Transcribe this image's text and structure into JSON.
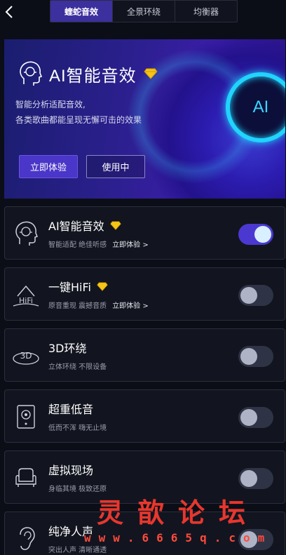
{
  "header": {
    "tabs": [
      {
        "label": "蝰蛇音效",
        "active": true
      },
      {
        "label": "全景环绕",
        "active": false
      },
      {
        "label": "均衡器",
        "active": false
      }
    ]
  },
  "banner": {
    "title": "AI智能音效",
    "desc_line1": "智能分析适配音效,",
    "desc_line2": "各类歌曲都能呈现无懈可击的效果",
    "try_button": "立即体验",
    "using_button": "使用中",
    "orb_text": "AI"
  },
  "effects": [
    {
      "title": "AI智能音效",
      "premium": true,
      "subtitle": "智能适配 绝佳听感",
      "link": "立即体验 >",
      "on": true,
      "icon": "ai-head-icon"
    },
    {
      "title": "一键HiFi",
      "premium": true,
      "subtitle": "原音重现 震撼音质",
      "link": "立即体验 >",
      "on": false,
      "icon": "hifi-icon"
    },
    {
      "title": "3D环绕",
      "premium": false,
      "subtitle": "立体环绕 不限设备",
      "link": "",
      "on": false,
      "icon": "3d-surround-icon"
    },
    {
      "title": "超重低音",
      "premium": false,
      "subtitle": "低而不浑 嗨无止境",
      "link": "",
      "on": false,
      "icon": "speaker-icon"
    },
    {
      "title": "虚拟现场",
      "premium": false,
      "subtitle": "身临其境 极致还原",
      "link": "",
      "on": false,
      "icon": "armchair-icon"
    },
    {
      "title": "纯净人声",
      "premium": false,
      "subtitle": "突出人声 清晰通透",
      "link": "",
      "on": false,
      "icon": "ear-icon"
    }
  ],
  "watermark": {
    "title": "灵歆论坛",
    "url": "www.6665q.com"
  },
  "colors": {
    "accent": "#4b38d0",
    "gem": "#f5c518",
    "watermark": "#ff3b30"
  }
}
